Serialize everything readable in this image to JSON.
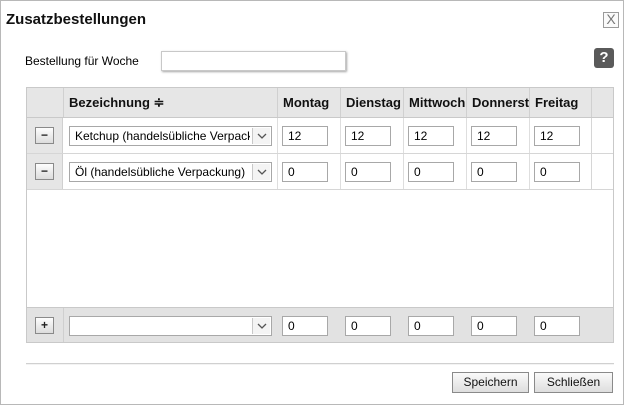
{
  "dialog": {
    "title": "Zusatzbestellungen",
    "close_glyph": "X",
    "week_label": "Bestellung für Woche",
    "week_value": "",
    "help_glyph": "?"
  },
  "table": {
    "columns": [
      "Bezeichnung ≑",
      "Montag",
      "Dienstag",
      "Mittwoch",
      "Donnerstag",
      "Freitag"
    ],
    "rows": [
      {
        "remove_glyph": "−",
        "item": "Ketchup (handelsübliche Verpackung)",
        "values": [
          "12",
          "12",
          "12",
          "12",
          "12"
        ]
      },
      {
        "remove_glyph": "−",
        "item": "Öl (handelsübliche Verpackung)",
        "values": [
          "0",
          "0",
          "0",
          "0",
          "0"
        ]
      }
    ],
    "new_row": {
      "add_glyph": "+",
      "item": "",
      "values": [
        "0",
        "0",
        "0",
        "0",
        "0"
      ]
    }
  },
  "buttons": {
    "save": "Speichern",
    "close": "Schließen"
  },
  "icons": {
    "close": "close-icon",
    "help": "help-icon",
    "dropdown": "chevron-down-icon"
  }
}
